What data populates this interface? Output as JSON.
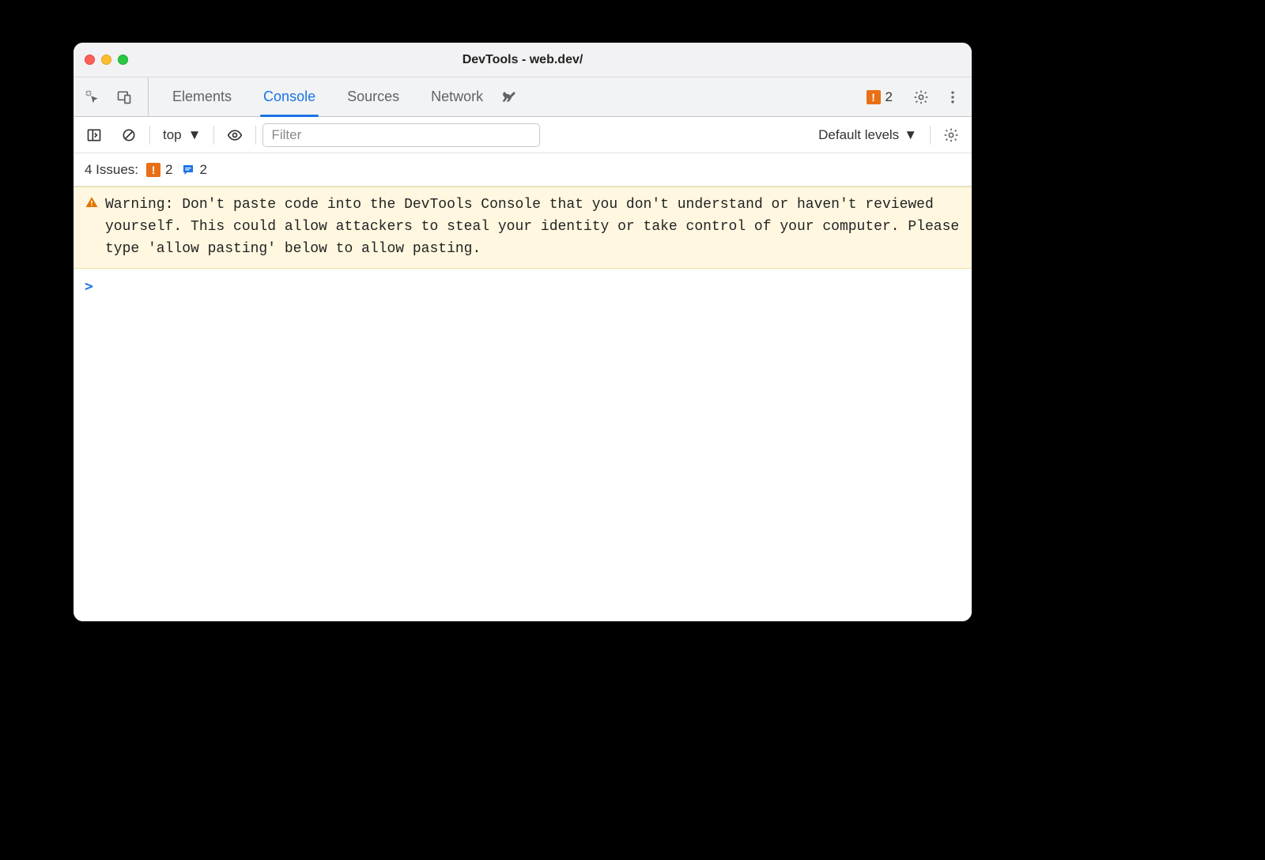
{
  "window": {
    "title": "DevTools - web.dev/"
  },
  "tabs": {
    "elements": "Elements",
    "console": "Console",
    "sources": "Sources",
    "network": "Network"
  },
  "header_issue_count": "2",
  "controlbar": {
    "context": "top",
    "filter_placeholder": "Filter",
    "levels": "Default levels"
  },
  "issuesrow": {
    "prefix": "4 Issues:",
    "warn_count": "2",
    "comment_count": "2"
  },
  "warning": {
    "label": "Warning:",
    "text": "Don't paste code into the DevTools Console that you don't understand or haven't reviewed yourself. This could allow attackers to steal your identity or take control of your computer. Please type 'allow pasting' below to allow pasting."
  },
  "prompt_marker": ">"
}
